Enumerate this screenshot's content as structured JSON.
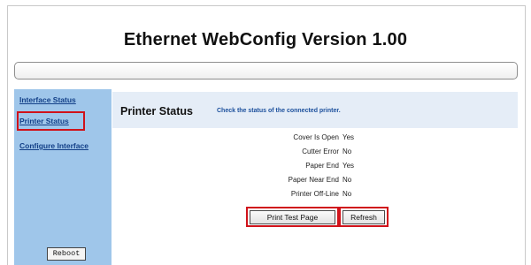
{
  "app": {
    "title": "Ethernet WebConfig Version 1.00"
  },
  "sidebar": {
    "items": [
      {
        "label": "Interface Status"
      },
      {
        "label": "Printer Status"
      },
      {
        "label": "Configure Interface"
      }
    ],
    "reboot_label": "Reboot"
  },
  "main": {
    "title": "Printer Status",
    "subtitle": "Check the status of the connected printer.",
    "status_rows": [
      {
        "label": "Cover Is Open",
        "value": "Yes"
      },
      {
        "label": "Cutter Error",
        "value": "No"
      },
      {
        "label": "Paper End",
        "value": "Yes"
      },
      {
        "label": "Paper Near End",
        "value": "No"
      },
      {
        "label": "Printer Off-Line",
        "value": "No"
      }
    ],
    "print_test_label": "Print Test Page",
    "refresh_label": "Refresh"
  },
  "colors": {
    "sidebar_bg": "#9fc6ea",
    "header_bg": "#e5edf7",
    "link": "#123f87",
    "highlight": "#d0121a"
  }
}
